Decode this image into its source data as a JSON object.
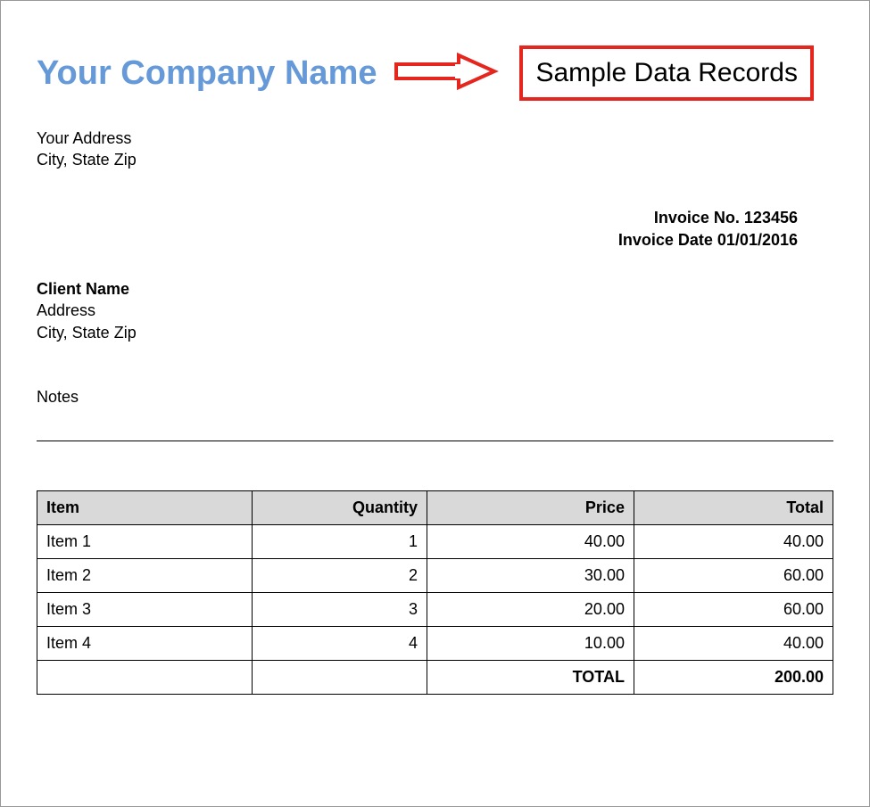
{
  "header": {
    "company_name": "Your Company Name",
    "callout": "Sample Data Records"
  },
  "company": {
    "address_line1": "Your Address",
    "address_line2": "City, State Zip"
  },
  "invoice": {
    "number_label": "Invoice No.",
    "number": "123456",
    "date_label": "Invoice Date",
    "date": "01/01/2016"
  },
  "client": {
    "name": "Client Name",
    "address_line1": "Address",
    "address_line2": "City, State Zip"
  },
  "notes_label": "Notes",
  "table": {
    "columns": {
      "item": "Item",
      "quantity": "Quantity",
      "price": "Price",
      "total": "Total"
    },
    "rows": [
      {
        "item": "Item 1",
        "quantity": "1",
        "price": "40.00",
        "total": "40.00"
      },
      {
        "item": "Item 2",
        "quantity": "2",
        "price": "30.00",
        "total": "60.00"
      },
      {
        "item": "Item 3",
        "quantity": "3",
        "price": "20.00",
        "total": "60.00"
      },
      {
        "item": "Item 4",
        "quantity": "4",
        "price": "10.00",
        "total": "40.00"
      }
    ],
    "total_label": "TOTAL",
    "total_value": "200.00"
  },
  "colors": {
    "company_name": "#6699d8",
    "callout_border": "#e4261e"
  }
}
